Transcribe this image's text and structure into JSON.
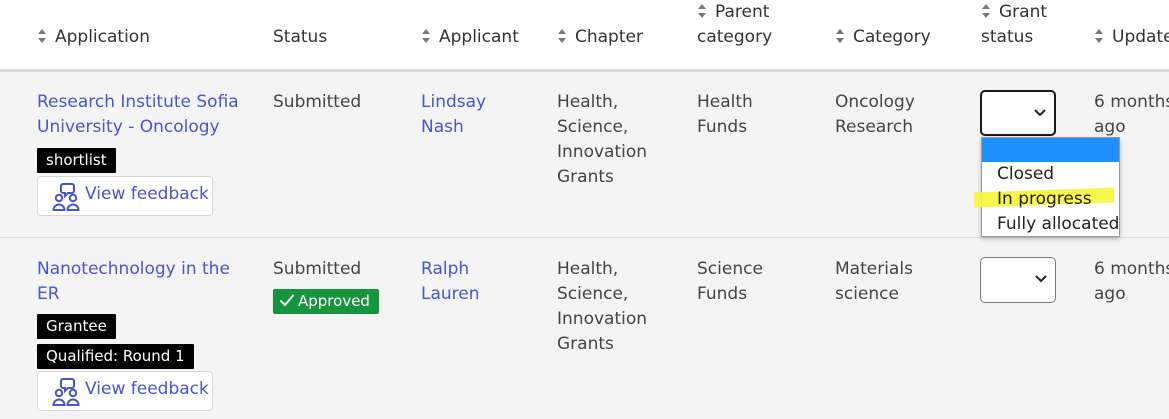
{
  "columns": {
    "application": "Application",
    "status": "Status",
    "applicant": "Applicant",
    "chapter": "Chapter",
    "parent_category_1": "Parent",
    "parent_category_2": "category",
    "category": "Category",
    "grant_status_1": "Grant",
    "grant_status_2": "status",
    "updated": "Update"
  },
  "rows": [
    {
      "application_line1": "Research Institute Sofia",
      "application_line2": "University - Oncology",
      "tags": [
        "shortlist"
      ],
      "feedback_label": "View feedback",
      "status": "Submitted",
      "applicant_line1": "Lindsay",
      "applicant_line2": "Nash",
      "chapter_lines": [
        "Health,",
        "Science,",
        "Innovation",
        "Grants"
      ],
      "parent_category_line1": "Health",
      "parent_category_line2": "Funds",
      "category_line1": "Oncology",
      "category_line2": "Research",
      "grant_status_value": "",
      "updated_line1": "6 months",
      "updated_line2": "ago"
    },
    {
      "application_line1": "Nanotechnology in the",
      "application_line2": "ER",
      "tags": [
        "Grantee",
        "Qualified: Round 1"
      ],
      "feedback_label": "View feedback",
      "status": "Submitted",
      "status_badge": "Approved",
      "applicant_line1": "Ralph",
      "applicant_line2": "Lauren",
      "chapter_lines": [
        "Health,",
        "Science,",
        "Innovation",
        "Grants"
      ],
      "parent_category_line1": "Science",
      "parent_category_line2": "Funds",
      "category_line1": "Materials",
      "category_line2": "science",
      "grant_status_value": "",
      "updated_line1": "6 months",
      "updated_line2": "ago"
    }
  ],
  "grant_status_options": [
    "",
    "Closed",
    "In progress",
    "Fully allocated"
  ],
  "colors": {
    "link": "#4a55c8",
    "approved": "#17953d",
    "tag_bg": "#000000",
    "dropdown_selected": "#1e90ff",
    "highlight": "#f5f53a"
  },
  "icons": {
    "sort": "sort-arrows-icon",
    "feedback": "feedback-people-icon",
    "check": "check-icon",
    "chevron": "chevron-down-icon"
  }
}
